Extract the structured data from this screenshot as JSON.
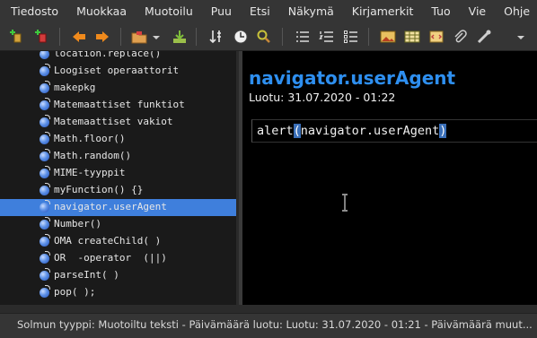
{
  "menubar": {
    "items": [
      "Tiedosto",
      "Muokkaa",
      "Muotoilu",
      "Puu",
      "Etsi",
      "Näkymä",
      "Kirjamerkit",
      "Tuo",
      "Vie",
      "Ohje"
    ]
  },
  "toolbar": {
    "icons": [
      "add-node-icon",
      "add-subnode-icon",
      "arrow-left-icon",
      "arrow-right-icon",
      "open-folder-icon",
      "dropdown-icon",
      "download-icon",
      "sort-icon",
      "clock-icon",
      "find-icon",
      "list-icon",
      "numbered-list-icon",
      "todo-list-icon",
      "image-icon",
      "table-icon",
      "codebox-icon",
      "attachment-icon",
      "anchor-icon",
      "overflow-icon"
    ]
  },
  "tree": {
    "items": [
      {
        "label": "location.replace()"
      },
      {
        "label": "Loogiset operaattorit"
      },
      {
        "label": "makepkg"
      },
      {
        "label": "Matemaattiset funktiot"
      },
      {
        "label": "Matemaattiset vakiot"
      },
      {
        "label": "Math.floor()"
      },
      {
        "label": "Math.random()"
      },
      {
        "label": "MIME-tyyppit"
      },
      {
        "label": "myFunction() {}"
      },
      {
        "label": "navigator.userAgent",
        "selected": true
      },
      {
        "label": "Number()"
      },
      {
        "label": "OMA createChild( )"
      },
      {
        "label": "OR  -operator  (||)"
      },
      {
        "label": "parseInt( )"
      },
      {
        "label": "pop( );"
      }
    ]
  },
  "content": {
    "title": "navigator.userAgent",
    "created": "Luotu: 31.07.2020 - 01:22",
    "code": {
      "before": "alert",
      "open": "(",
      "inner": "navigator.userAgent",
      "close": ")"
    }
  },
  "statusbar": {
    "text": "Solmun tyyppi: Muotoiltu teksti  -  Päivämäärä luotu: Luotu: 31.07.2020 - 01:21  -  Päivämäärä muut..."
  },
  "colors": {
    "accent": "#2e8ff0",
    "selection": "#3f7fdc",
    "paren_highlight": "#3a6fb8"
  }
}
